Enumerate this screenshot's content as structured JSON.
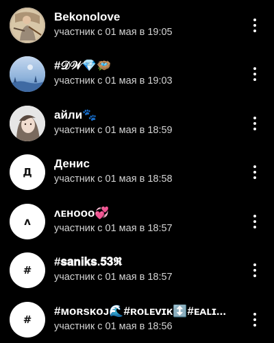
{
  "members": [
    {
      "name": "Bekonolove",
      "joined": "участник с 01 мая в 19:05",
      "avatar": {
        "type": "photo",
        "icon": "person-with-fan-photo"
      }
    },
    {
      "name": "#𝒟𝒲💎🪺",
      "joined": "участник с 01 мая в 19:03",
      "avatar": {
        "type": "photo",
        "icon": "blue-sky-landscape-photo"
      }
    },
    {
      "name": "айли🐾",
      "joined": "участник с 01 мая в 18:59",
      "avatar": {
        "type": "photo",
        "icon": "girl-portrait-photo"
      }
    },
    {
      "name": "Денис",
      "joined": "участник с 01 мая в 18:58",
      "avatar": {
        "type": "letter",
        "letter": "Д"
      }
    },
    {
      "name": "ʌᴇʜᴏᴏᴏ💞",
      "joined": "участник с 01 мая в 18:57",
      "avatar": {
        "type": "letter",
        "letter": "ʌ"
      }
    },
    {
      "name": "#𝐬𝐚𝐧𝐢𝐤𝐬.𝟓𝟑𝕽",
      "joined": "участник с 01 мая в 18:57",
      "avatar": {
        "type": "letter",
        "letter": "#"
      }
    },
    {
      "name": "#ᴍᴏʀsᴋᴏᴊ🌊#ʀᴏʟᴇᴠɪᴋ↕️#ᴇᴀʟɪ...",
      "joined": "участник с 01 мая в 18:56",
      "avatar": {
        "type": "letter",
        "letter": "#"
      }
    }
  ],
  "row_action_icon": "more-vertical-icon",
  "colors": {
    "background": "#000000",
    "name_text": "#ffffff",
    "subtitle_text": "#d4d4d4",
    "letter_avatar_bg": "#ffffff"
  }
}
